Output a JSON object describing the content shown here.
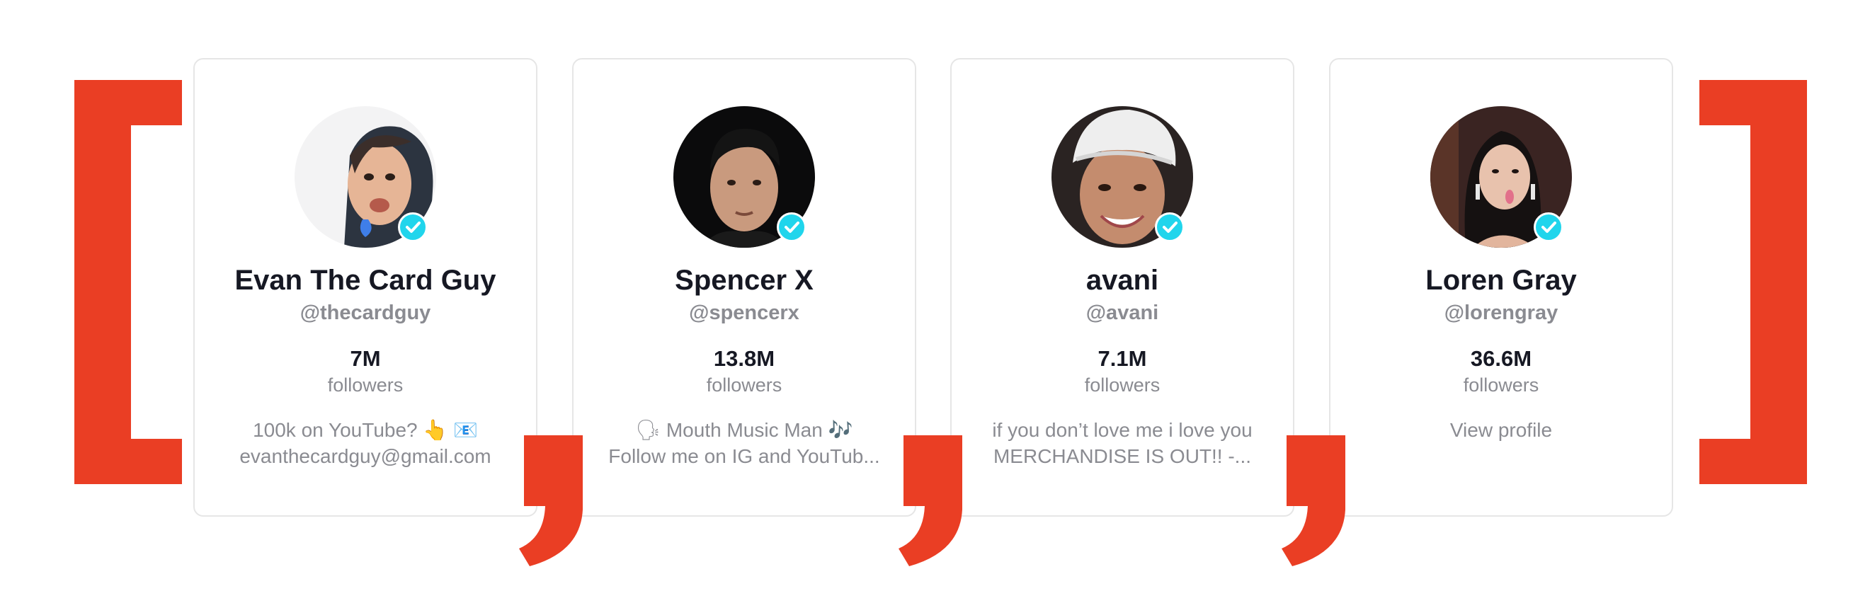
{
  "accent_color": "#ea3e24",
  "verified_color": "#20d5ec",
  "cards": [
    {
      "name": "Evan The Card Guy",
      "handle": "@thecardguy",
      "followers_count": "7M",
      "followers_label": "followers",
      "bio_line1": "100k on YouTube? 👆 📧",
      "bio_line2": "evanthecardguy@gmail.com"
    },
    {
      "name": "Spencer X",
      "handle": "@spencerx",
      "followers_count": "13.8M",
      "followers_label": "followers",
      "bio_line1": "🗣 Mouth Music Man 🎶",
      "bio_line2": "Follow me on IG and YouTub..."
    },
    {
      "name": "avani",
      "handle": "@avani",
      "followers_count": "7.1M",
      "followers_label": "followers",
      "bio_line1": "if you don’t love me i love you",
      "bio_line2": "MERCHANDISE IS OUT!! -..."
    },
    {
      "name": "Loren Gray",
      "handle": "@lorengray",
      "followers_count": "36.6M",
      "followers_label": "followers",
      "bio_line1": "View profile",
      "bio_line2": ""
    }
  ]
}
